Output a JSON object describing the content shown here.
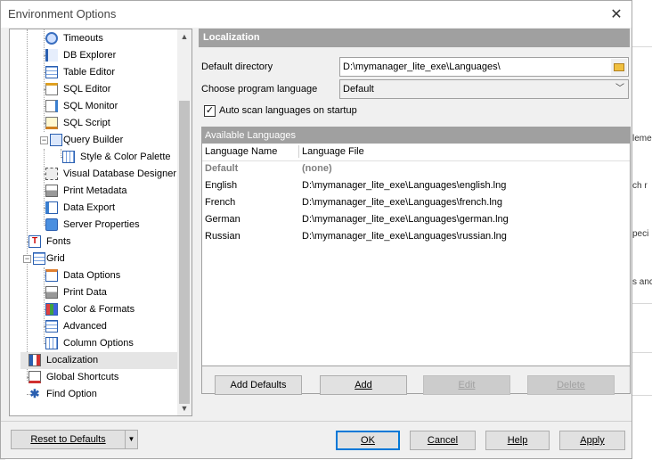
{
  "window": {
    "title": "Environment Options",
    "close": "✕"
  },
  "tree": {
    "items": [
      {
        "label": "Timeouts",
        "icon": "timeouts-icon"
      },
      {
        "label": "DB Explorer",
        "icon": "db-explorer-icon"
      },
      {
        "label": "Table Editor",
        "icon": "table-editor-icon"
      },
      {
        "label": "SQL Editor",
        "icon": "sql-editor-icon"
      },
      {
        "label": "SQL Monitor",
        "icon": "sql-monitor-icon"
      },
      {
        "label": "SQL Script",
        "icon": "sql-script-icon"
      },
      {
        "label": "Query Builder",
        "icon": "query-builder-icon"
      },
      {
        "label": "Style & Color Palette",
        "icon": "style-palette-icon"
      },
      {
        "label": "Visual Database Designer",
        "icon": "visual-designer-icon"
      },
      {
        "label": "Print Metadata",
        "icon": "printer-icon"
      },
      {
        "label": "Data Export",
        "icon": "data-export-icon"
      },
      {
        "label": "Server Properties",
        "icon": "server-icon"
      },
      {
        "label": "Fonts",
        "icon": "fonts-icon"
      },
      {
        "label": "Grid",
        "icon": "grid-icon"
      },
      {
        "label": "Data Options",
        "icon": "data-options-icon"
      },
      {
        "label": "Print Data",
        "icon": "printer-icon"
      },
      {
        "label": "Color & Formats",
        "icon": "color-formats-icon"
      },
      {
        "label": "Advanced",
        "icon": "advanced-icon"
      },
      {
        "label": "Column Options",
        "icon": "column-options-icon"
      },
      {
        "label": "Localization",
        "icon": "localization-icon"
      },
      {
        "label": "Global Shortcuts",
        "icon": "shortcuts-icon"
      },
      {
        "label": "Find Option",
        "icon": "find-option-icon"
      }
    ]
  },
  "panel": {
    "header": "Localization",
    "default_dir_label": "Default directory",
    "default_dir_value": "D:\\mymanager_lite_exe\\Languages\\",
    "lang_label": "Choose program language",
    "lang_value": "Default",
    "autoscan_label": "Auto scan languages on startup",
    "autoscan_checked": true,
    "available_header": "Available Languages",
    "columns": [
      "Language Name",
      "Language File"
    ],
    "rows": [
      {
        "name": "Default",
        "file": "(none)"
      },
      {
        "name": "English",
        "file": "D:\\mymanager_lite_exe\\Languages\\english.lng"
      },
      {
        "name": "French",
        "file": "D:\\mymanager_lite_exe\\Languages\\french.lng"
      },
      {
        "name": "German",
        "file": "D:\\mymanager_lite_exe\\Languages\\german.lng"
      },
      {
        "name": "Russian",
        "file": "D:\\mymanager_lite_exe\\Languages\\russian.lng"
      }
    ],
    "buttons": {
      "add_defaults": "Add Defaults",
      "add": "Add",
      "edit": "Edit",
      "delete": "Delete"
    }
  },
  "footer": {
    "reset": "Reset to Defaults",
    "ok": "OK",
    "cancel": "Cancel",
    "help": "Help",
    "apply": "Apply"
  },
  "background_text": [
    "leme",
    "ch r",
    "peci",
    "s anc"
  ]
}
